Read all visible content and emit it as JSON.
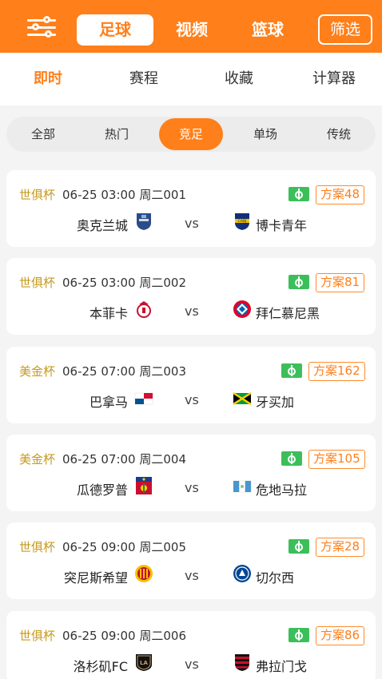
{
  "header": {
    "menu_icon": "settings-sliders-icon",
    "tabs": [
      "足球",
      "视频",
      "篮球"
    ],
    "active_tab": "足球",
    "filter_label": "筛选"
  },
  "subnav": {
    "items": [
      "即时",
      "赛程",
      "收藏",
      "计算器"
    ],
    "active": "即时"
  },
  "filters": {
    "items": [
      "全部",
      "热门",
      "竞足",
      "单场",
      "传统"
    ],
    "active": "竞足"
  },
  "matches": [
    {
      "league": "世俱杯",
      "time": "06-25 03:00",
      "code": "周二001",
      "plan": "方案48",
      "home": "奥克兰城",
      "away": "博卡青年",
      "vs": "vs",
      "home_logo": "auckland-city-logo",
      "away_logo": "boca-juniors-logo"
    },
    {
      "league": "世俱杯",
      "time": "06-25 03:00",
      "code": "周二002",
      "plan": "方案81",
      "home": "本菲卡",
      "away": "拜仁慕尼黑",
      "vs": "vs",
      "home_logo": "benfica-logo",
      "away_logo": "bayern-munich-logo"
    },
    {
      "league": "美金杯",
      "time": "06-25 07:00",
      "code": "周二003",
      "plan": "方案162",
      "home": "巴拿马",
      "away": "牙买加",
      "vs": "vs",
      "home_logo": "panama-flag",
      "away_logo": "jamaica-flag"
    },
    {
      "league": "美金杯",
      "time": "06-25 07:00",
      "code": "周二004",
      "plan": "方案105",
      "home": "瓜德罗普",
      "away": "危地马拉",
      "vs": "vs",
      "home_logo": "guadeloupe-flag",
      "away_logo": "guatemala-flag"
    },
    {
      "league": "世俱杯",
      "time": "06-25 09:00",
      "code": "周二005",
      "plan": "方案28",
      "home": "突尼斯希望",
      "away": "切尔西",
      "vs": "vs",
      "home_logo": "esperance-tunis-logo",
      "away_logo": "chelsea-logo"
    },
    {
      "league": "世俱杯",
      "time": "06-25 09:00",
      "code": "周二006",
      "plan": "方案86",
      "home": "洛杉矶FC",
      "away": "弗拉门戈",
      "vs": "vs",
      "home_logo": "lafc-logo",
      "away_logo": "flamengo-logo"
    }
  ],
  "colors": {
    "accent": "#ff7f1a",
    "league_gold": "#c69a1d",
    "field_green": "#3cbf5a"
  }
}
